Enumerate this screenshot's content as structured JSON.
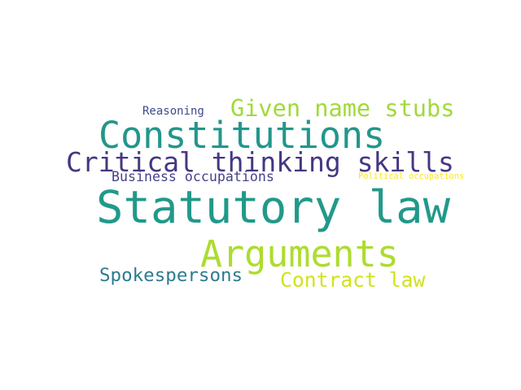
{
  "words": [
    {
      "text": "Reasoning",
      "color": "#3e4a89"
    },
    {
      "text": "Given name stubs",
      "color": "#a0da39"
    },
    {
      "text": "Constitutions",
      "color": "#23968b"
    },
    {
      "text": "Critical thinking skills",
      "color": "#453781"
    },
    {
      "text": "Business occupations",
      "color": "#46428a"
    },
    {
      "text": "Political occupations",
      "color": "#fde725"
    },
    {
      "text": "Statutory law",
      "color": "#21998a"
    },
    {
      "text": "Arguments",
      "color": "#addc30"
    },
    {
      "text": "Spokespersons",
      "color": "#2c7b8e"
    },
    {
      "text": "Contract law",
      "color": "#d2e21b"
    }
  ]
}
